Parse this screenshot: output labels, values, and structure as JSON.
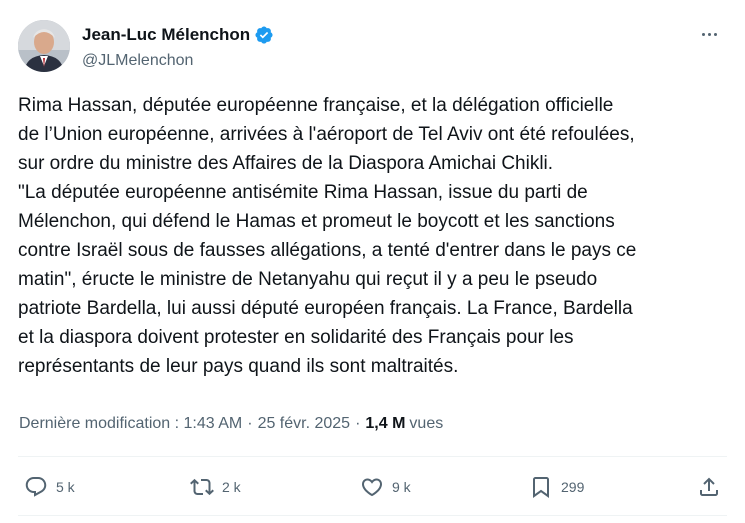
{
  "author": {
    "name": "Jean-Luc Mélenchon",
    "handle": "@JLMelenchon",
    "verified_color": "#1d9bf0"
  },
  "tweet": {
    "lines": [
      "Rima Hassan, députée européenne française, et la délégation officielle",
      "de l’Union européenne, arrivées à l'aéroport de Tel Aviv ont été refoulées,",
      "sur ordre du ministre des Affaires de la Diaspora Amichai Chikli.",
      "\"La députée européenne antisémite Rima Hassan, issue du parti de",
      "Mélenchon, qui défend le Hamas et promeut le boycott et les sanctions",
      "contre Israël sous de fausses allégations, a tenté d'entrer dans le pays ce",
      "matin\", éructe le ministre de Netanyahu qui reçut il y a peu le pseudo",
      "patriote Bardella, lui aussi député européen français. La France, Bardella",
      "et la diaspora doivent protester en solidarité des Français pour les",
      "représentants de leur pays quand ils sont maltraités."
    ]
  },
  "meta": {
    "edited_label": "Dernière modification :",
    "time": "1:43 AM",
    "date": "25 févr. 2025",
    "separator": "·",
    "views_count": "1,4 M",
    "views_label": "vues"
  },
  "actions": {
    "reply_count": "5 k",
    "retweet_count": "2 k",
    "like_count": "9 k",
    "bookmark_count": "299"
  },
  "icons": {
    "verified": "verified-badge-icon",
    "more": "more-options-icon",
    "reply": "reply-icon",
    "retweet": "retweet-icon",
    "like": "heart-icon",
    "bookmark": "bookmark-icon",
    "share": "share-icon"
  }
}
